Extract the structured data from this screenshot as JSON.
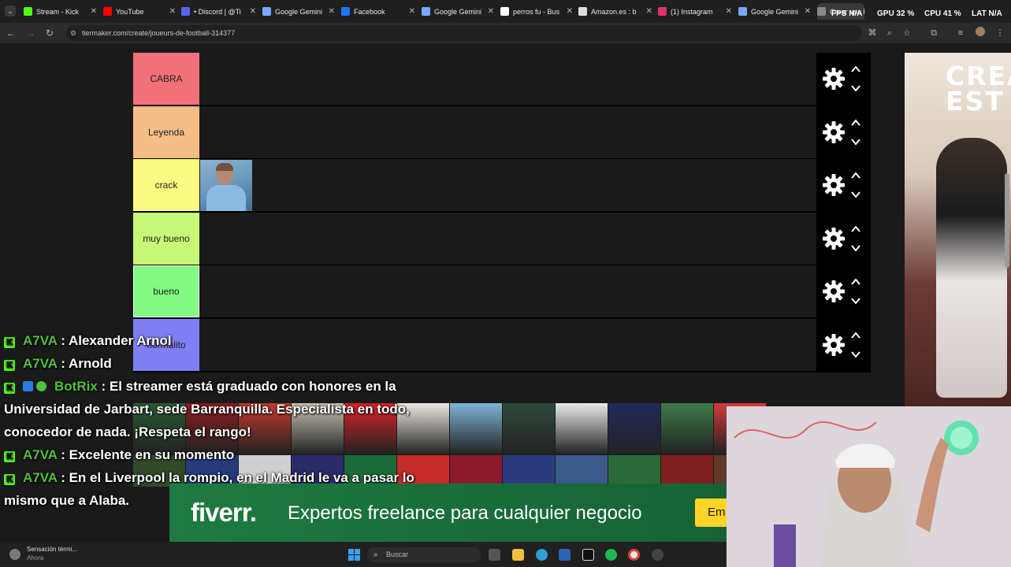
{
  "browser": {
    "tabs": [
      {
        "label": "Stream - Kick",
        "favicon_color": "#53fc18"
      },
      {
        "label": "YouTube",
        "favicon_color": "#ff0000"
      },
      {
        "label": "• Discord | @Ti",
        "favicon_color": "#5865f2"
      },
      {
        "label": "Google Gemini",
        "favicon_color": "#7aa7ff"
      },
      {
        "label": "Facebook",
        "favicon_color": "#1877f2"
      },
      {
        "label": "Google Gemini",
        "favicon_color": "#7aa7ff"
      },
      {
        "label": "perros fu - Bus",
        "favicon_color": "#ffffff"
      },
      {
        "label": "Amazon.es : b",
        "favicon_color": "#dddddd"
      },
      {
        "label": "(1) Instagram",
        "favicon_color": "#e1306c"
      },
      {
        "label": "Google Gemini",
        "favicon_color": "#7aa7ff"
      },
      {
        "label": "Crear una lista",
        "favicon_color": "#888888"
      }
    ],
    "url": "tiermaker.com/create/joueurs-de-football-314377",
    "overlay_stats": {
      "fps": "FPS N/A",
      "gpu": "GPU 32 %",
      "cpu": "CPU 41 %",
      "lat": "LAT N/A"
    }
  },
  "tiers": [
    {
      "label": "CABRA",
      "color": "#f2707a"
    },
    {
      "label": "Leyenda",
      "color": "#f5bd88"
    },
    {
      "label": "crack",
      "color": "#fbfb83"
    },
    {
      "label": "muy bueno",
      "color": "#c8f877"
    },
    {
      "label": "bueno",
      "color": "#83fb83"
    },
    {
      "label": "normalito",
      "color": "#7f7ff3"
    }
  ],
  "tier_controls": {
    "settings_icon": "gear-icon",
    "up_icon": "chevron-up-icon",
    "down_icon": "chevron-down-icon"
  },
  "player_image_tier": "crack",
  "ad_banner_text": "CREA\nEST",
  "chat": [
    {
      "user": "A7VA",
      "text": "Alexander Arnol"
    },
    {
      "user": "A7VA",
      "text": "Arnold"
    },
    {
      "user": "BotRix",
      "text": "El streamer está graduado con honores en la Universidad de Jarbart, sede Barranquilla. Especialista en todo, conocedor de nada. ¡Respeta el rango!"
    },
    {
      "user": "A7VA",
      "text": "Excelente en su momento"
    },
    {
      "user": "A7VA",
      "text": "En el Liverpool la rompio, en el Madrid le va a pasar lo mismo que a Alaba."
    }
  ],
  "fiverr_ad": {
    "logo": "fiverr.",
    "text": "Expertos freelance para cualquier negocio",
    "button": "Em"
  },
  "taskbar": {
    "weather_title": "Sensación térmi...",
    "weather_sub": "Ahora",
    "search_placeholder": "Buscar"
  }
}
